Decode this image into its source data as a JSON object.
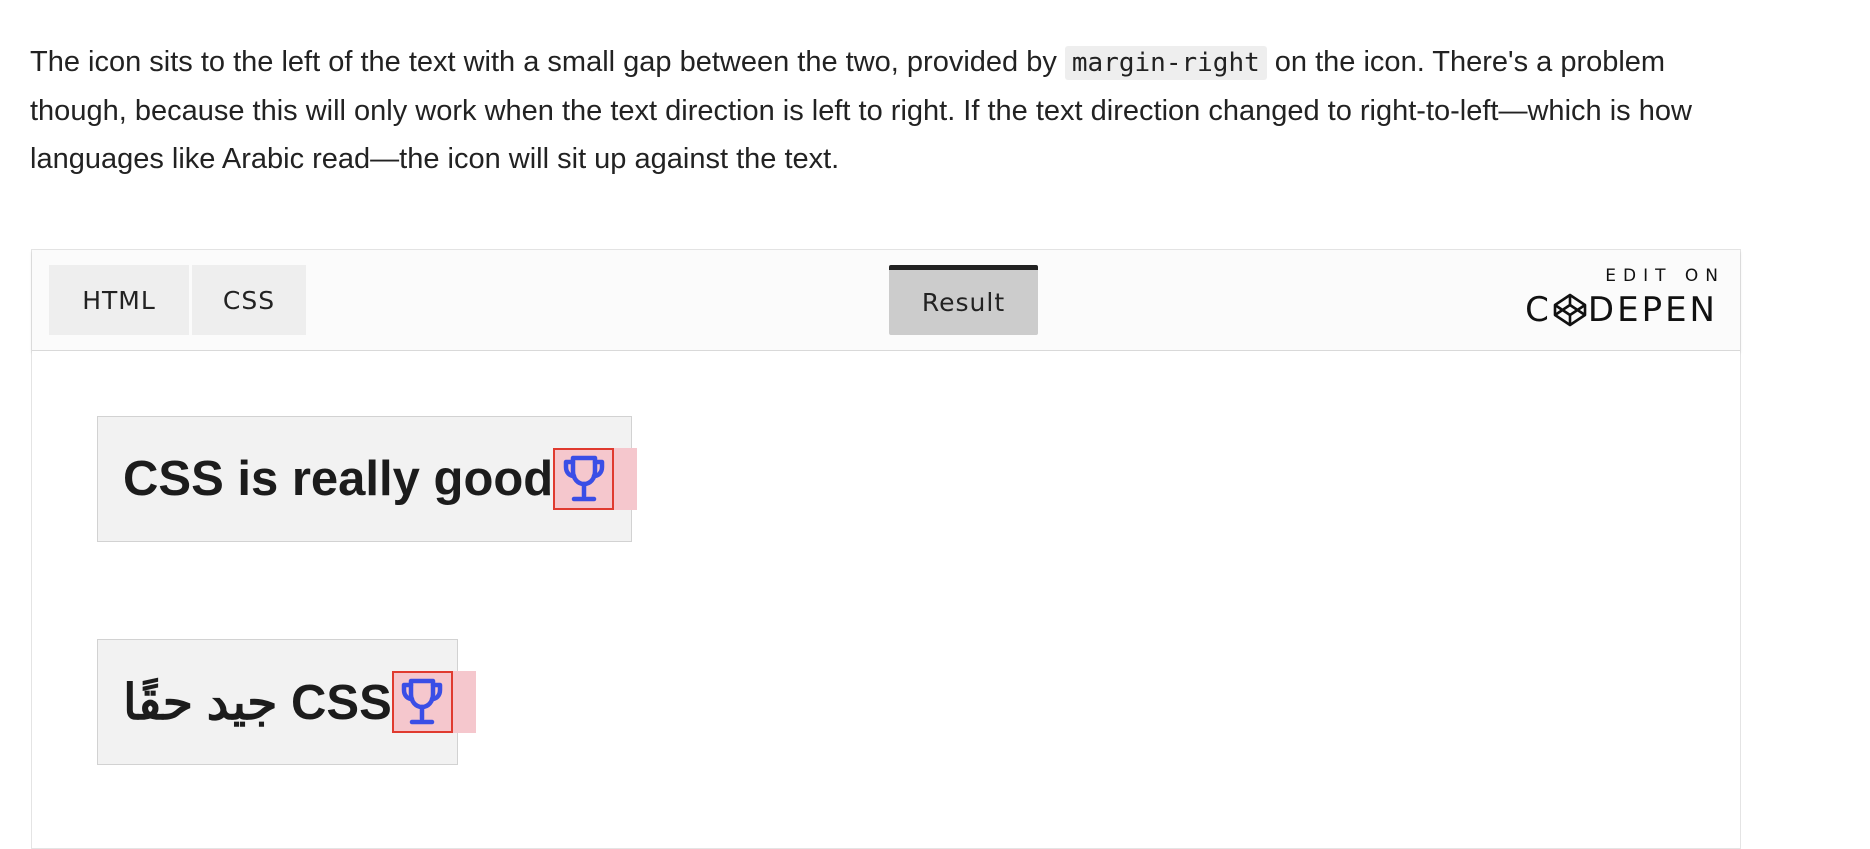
{
  "article": {
    "text_before": "The icon sits to the left of the text with a small gap between the two, provided by ",
    "code": "margin-right",
    "text_after": " on the icon. There's a problem though, because this will only work when the text direction is left to right. If the text direction changed to right-to-left—which is how languages like Arabic read—the icon will sit up against the text."
  },
  "embed": {
    "tabs": {
      "html": "HTML",
      "css": "CSS",
      "result": "Result"
    },
    "logo": {
      "edit_on": "EDIT ON",
      "brand_prefix": "C",
      "brand_suffix": "DEPEN",
      "icon": "codepen-icon"
    },
    "demo": {
      "ltr_text": "CSS is really good",
      "rtl_text": "CSS جيد حقًا",
      "icon": "trophy-icon"
    }
  },
  "colors": {
    "icon_color": "#3a4ee6",
    "margin_highlight": "#f5c7cd",
    "icon_outline": "#e03a2f",
    "demo_background": "#f2f2f2",
    "result_tab_background": "#cccccc"
  }
}
